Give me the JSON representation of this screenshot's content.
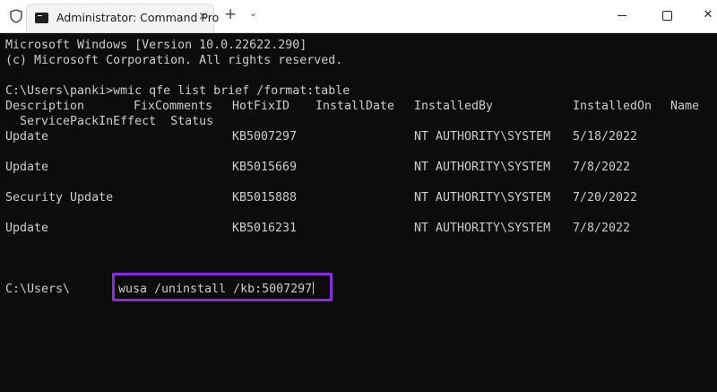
{
  "titlebar": {
    "tab_title": "Administrator: Command Pro",
    "tab_close": "×",
    "new_tab": "+",
    "dropdown": "⌄",
    "maximize": "",
    "close": "✕"
  },
  "terminal": {
    "header_lines": [
      "Microsoft Windows [Version 10.0.22622.290]",
      "(c) Microsoft Corporation. All rights reserved."
    ],
    "command_line": "C:\\Users\\panki>wmic qfe list brief /format:table",
    "table": {
      "columns": [
        "Description",
        "FixComments",
        "HotFixID",
        "InstallDate",
        "InstalledBy",
        "InstalledOn",
        "Name"
      ],
      "columns_wrap": "  ServicePackInEffect  Status",
      "rows": [
        {
          "description": "Update",
          "hotfix": "KB5007297",
          "installed_by": "NT AUTHORITY\\SYSTEM",
          "installed_on": "5/18/2022"
        },
        {
          "description": "Update",
          "hotfix": "KB5015669",
          "installed_by": "NT AUTHORITY\\SYSTEM",
          "installed_on": "7/8/2022"
        },
        {
          "description": "Security Update",
          "hotfix": "KB5015888",
          "installed_by": "NT AUTHORITY\\SYSTEM",
          "installed_on": "7/20/2022"
        },
        {
          "description": "Update",
          "hotfix": "KB5016231",
          "installed_by": "NT AUTHORITY\\SYSTEM",
          "installed_on": "7/8/2022"
        }
      ]
    },
    "prompt": "C:\\Users\\",
    "input_command": "wusa /uninstall /kb:5007297"
  },
  "colors": {
    "terminal_bg": "#0c0c0c",
    "terminal_fg": "#cccccc",
    "highlight": "#8a2be2"
  }
}
